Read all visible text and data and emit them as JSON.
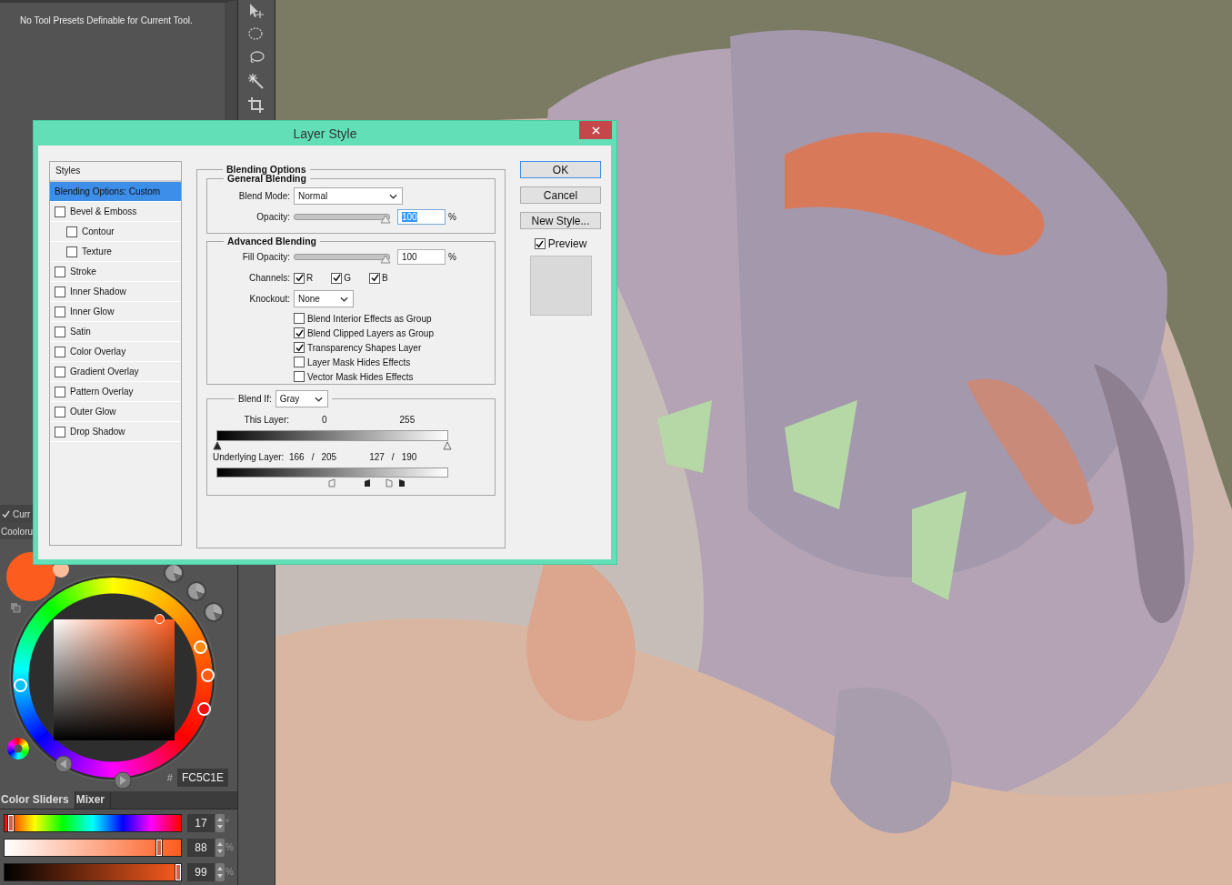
{
  "tool_presets": {
    "message": "No Tool Presets Definable for Current Tool."
  },
  "panel_options": {
    "current_checkbox": {
      "label": "Curr",
      "checked": true
    },
    "panel_title": "Cooloru"
  },
  "color_panel": {
    "hex_prefix": "#",
    "hex": "FC5C1E",
    "tabs": [
      {
        "label": "Color Sliders",
        "selected": true
      },
      {
        "label": "Mixer",
        "selected": false
      }
    ],
    "sliders": [
      {
        "kind": "hue",
        "level": 0.04,
        "value": "17",
        "unit": "°"
      },
      {
        "kind": "saturation",
        "level": 0.88,
        "value": "88",
        "unit": "%"
      },
      {
        "kind": "brightness",
        "level": 0.99,
        "value": "99",
        "unit": "%"
      }
    ]
  },
  "dialog": {
    "title": "Layer Style",
    "styles_list": {
      "header": "Styles",
      "items": [
        {
          "label": "Blending Options: Custom",
          "kind": "plain",
          "selected": true
        },
        {
          "label": "Bevel & Emboss",
          "kind": "check",
          "checked": false,
          "selected": false,
          "children": [
            {
              "label": "Contour",
              "kind": "check",
              "checked": false,
              "selected": false
            },
            {
              "label": "Texture",
              "kind": "check",
              "checked": false,
              "selected": false
            }
          ]
        },
        {
          "label": "Stroke",
          "kind": "check",
          "checked": false,
          "selected": false
        },
        {
          "label": "Inner Shadow",
          "kind": "check",
          "checked": false,
          "selected": false
        },
        {
          "label": "Inner Glow",
          "kind": "check",
          "checked": false,
          "selected": false
        },
        {
          "label": "Satin",
          "kind": "check",
          "checked": false,
          "selected": false
        },
        {
          "label": "Color Overlay",
          "kind": "check",
          "checked": false,
          "selected": false
        },
        {
          "label": "Gradient Overlay",
          "kind": "check",
          "checked": false,
          "selected": false
        },
        {
          "label": "Pattern Overlay",
          "kind": "check",
          "checked": false,
          "selected": false
        },
        {
          "label": "Outer Glow",
          "kind": "check",
          "checked": false,
          "selected": false
        },
        {
          "label": "Drop Shadow",
          "kind": "check",
          "checked": false,
          "selected": false
        }
      ]
    },
    "blending_options": {
      "title": "Blending Options",
      "general": {
        "title": "General Blending",
        "blend_mode": {
          "label": "Blend Mode:",
          "value": "Normal"
        },
        "opacity": {
          "label": "Opacity:",
          "level": 1,
          "value": "100",
          "unit": "%",
          "value_selected": true
        }
      },
      "advanced": {
        "title": "Advanced Blending",
        "fill_opacity": {
          "label": "Fill Opacity:",
          "level": 1,
          "value": "100",
          "unit": "%",
          "value_selected": false
        },
        "channels": {
          "label": "Channels:",
          "items": [
            {
              "label": "R",
              "checked": true
            },
            {
              "label": "G",
              "checked": true
            },
            {
              "label": "B",
              "checked": true
            }
          ]
        },
        "knockout": {
          "label": "Knockout:",
          "value": "None"
        },
        "options": [
          {
            "label": "Blend Interior Effects as Group",
            "checked": false
          },
          {
            "label": "Blend Clipped Layers as Group",
            "checked": true
          },
          {
            "label": "Transparency Shapes Layer",
            "checked": true
          },
          {
            "label": "Layer Mask Hides Effects",
            "checked": false
          },
          {
            "label": "Vector Mask Hides Effects",
            "checked": false
          }
        ]
      },
      "blend_if": {
        "label": "Blend If:",
        "value": "Gray",
        "this_layer": {
          "label": "This Layer:",
          "low": "0",
          "high": "255"
        },
        "underlying_layer": {
          "label": "Underlying Layer:",
          "low": "166",
          "low_separator": "/",
          "low_split": "205",
          "high": "127",
          "high_separator": "/",
          "high_split": "190"
        }
      }
    },
    "buttons": [
      {
        "label": "OK",
        "default": true
      },
      {
        "label": "Cancel",
        "default": false
      },
      {
        "label": "New Style...",
        "default": false
      }
    ],
    "preview": {
      "label": "Preview",
      "checked": true
    }
  }
}
